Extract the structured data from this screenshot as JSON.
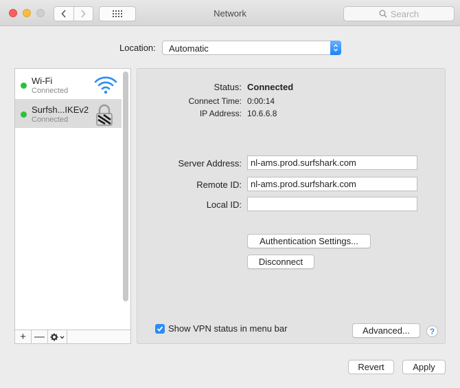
{
  "window": {
    "title": "Network"
  },
  "toolbar": {
    "search_placeholder": "Search"
  },
  "location": {
    "label": "Location:",
    "value": "Automatic"
  },
  "sidebar": {
    "services": [
      {
        "name": "Wi-Fi",
        "status": "Connected",
        "icon": "wifi-icon",
        "status_color": "#2ac23a"
      },
      {
        "name": "Surfsh...IKEv2",
        "status": "Connected",
        "icon": "vpn-lock-icon",
        "status_color": "#2ac23a",
        "selected": true
      }
    ],
    "toolbar": {
      "add": "+",
      "remove": "—"
    }
  },
  "detail": {
    "status_label": "Status:",
    "status_value": "Connected",
    "connect_time_label": "Connect Time:",
    "connect_time_value": "0:00:14",
    "ip_label": "IP Address:",
    "ip_value": "10.6.6.8",
    "server_label": "Server Address:",
    "server_value": "nl-ams.prod.surfshark.com",
    "remote_label": "Remote ID:",
    "remote_value": "nl-ams.prod.surfshark.com",
    "local_label": "Local ID:",
    "local_value": "",
    "auth_button": "Authentication Settings...",
    "disconnect_button": "Disconnect",
    "show_status_label": "Show VPN status in menu bar",
    "show_status_checked": true,
    "advanced_button": "Advanced...",
    "help": "?"
  },
  "footer": {
    "revert": "Revert",
    "apply": "Apply"
  },
  "colors": {
    "accent": "#2e8cf6",
    "connected": "#2ac23a"
  }
}
